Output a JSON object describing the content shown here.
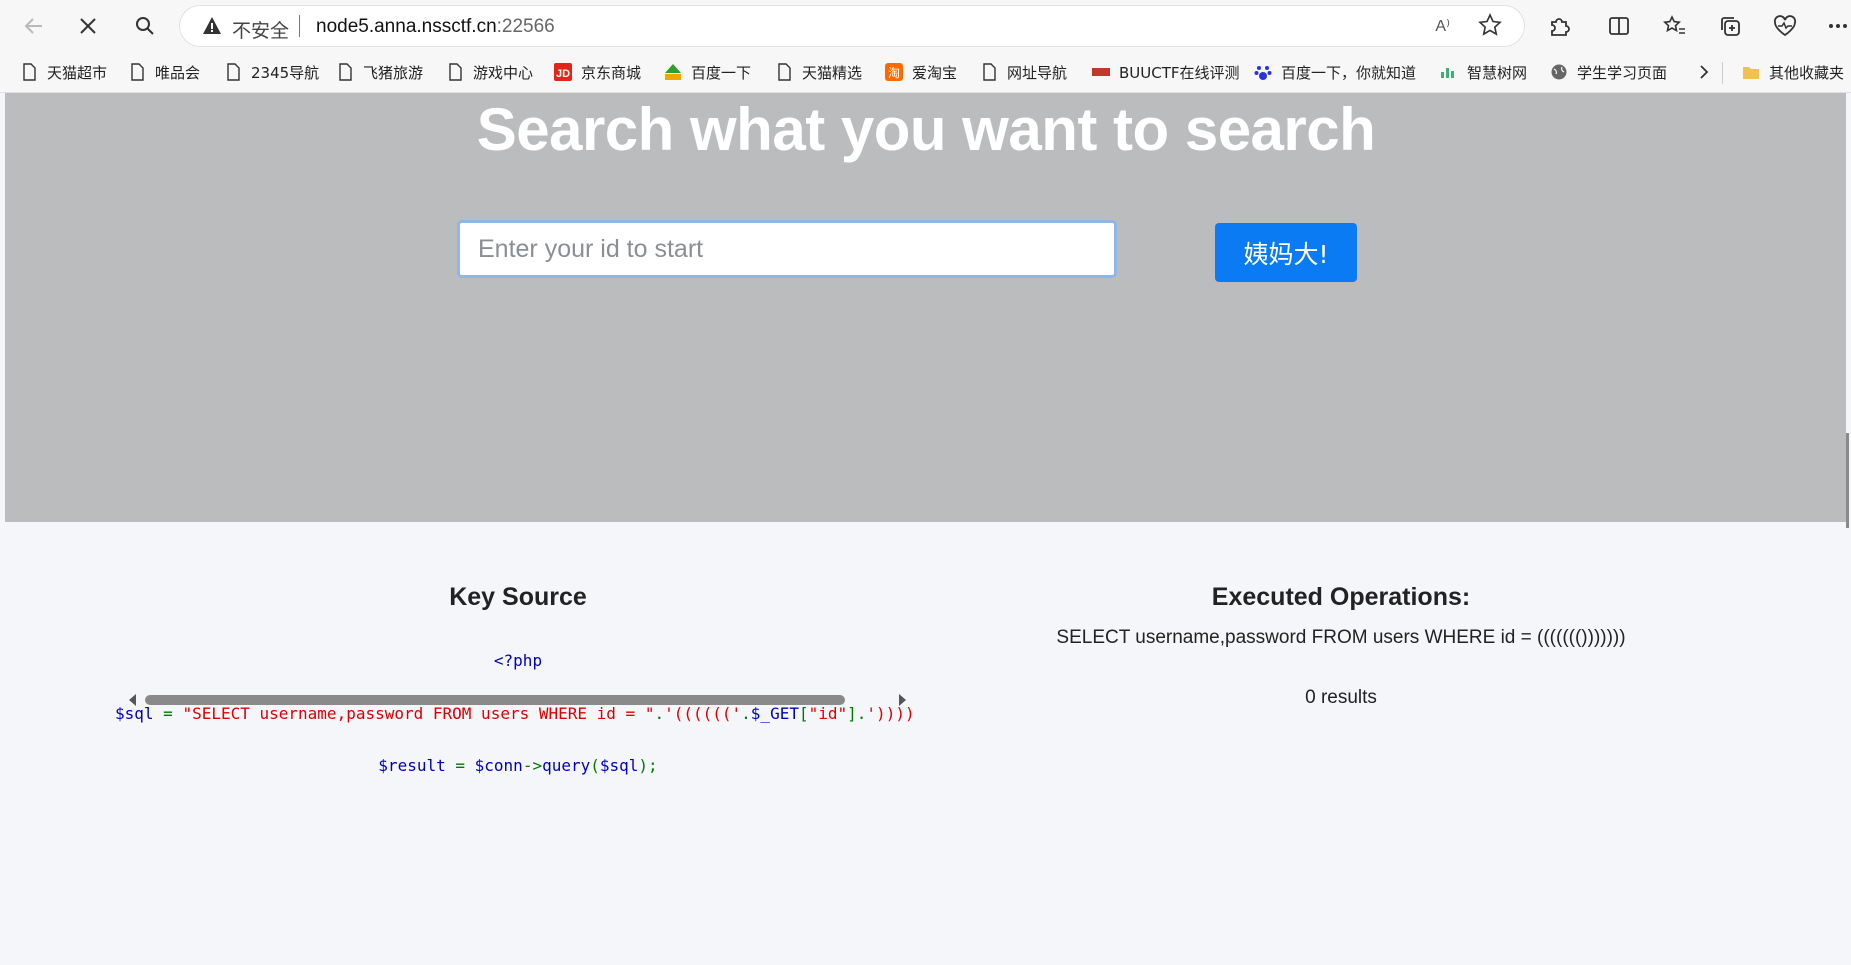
{
  "browser": {
    "insecure_label": "不安全",
    "url_host": "node5.anna.nssctf.cn",
    "url_port": ":22566",
    "read_aloud": "A⁾",
    "bookmarks": [
      "天猫超市",
      "唯品会",
      "2345导航",
      "飞猪旅游",
      "游戏中心",
      "京东商城",
      "百度一下",
      "天猫精选",
      "爱淘宝",
      "网址导航",
      "BUUCTF在线评测",
      "百度一下，你就知道",
      "智慧树网",
      "学生学习页面",
      "其他收藏夹"
    ]
  },
  "hero": {
    "title": "Search what you want to search",
    "search_placeholder": "Enter your id to start",
    "search_button": "姨妈大!"
  },
  "key_source": {
    "heading": "Key Source",
    "line1": "<?php",
    "line2_var": "$sql",
    "line2_eq": " = ",
    "line2_str1": "\"SELECT username,password FROM users WHERE id = \"",
    "line2_dot1": ".",
    "line2_str2": "'(((((('",
    "line2_dot2": ".",
    "line2_get": "$_GET",
    "line2_br1": "[",
    "line2_key": "\"id\"",
    "line2_br2": "]",
    "line2_dot3": ".",
    "line2_str3": "'))))",
    "line3_var": "$result",
    "line3_eq": " = ",
    "line3_conn": "$conn",
    "line3_arrow": "->",
    "line3_query": "query",
    "line3_paren1": "(",
    "line3_sql": "$sql",
    "line3_paren2": ");"
  },
  "executed": {
    "heading": "Executed Operations:",
    "query": "SELECT username,password FROM users WHERE id = ((((((()))))))",
    "results": "0 results"
  },
  "colors": {
    "hero_bg": "#babcbe",
    "button": "#0a7bf2",
    "php_var": "#0000bb",
    "php_str": "#dd0000",
    "php_op": "#007700"
  }
}
